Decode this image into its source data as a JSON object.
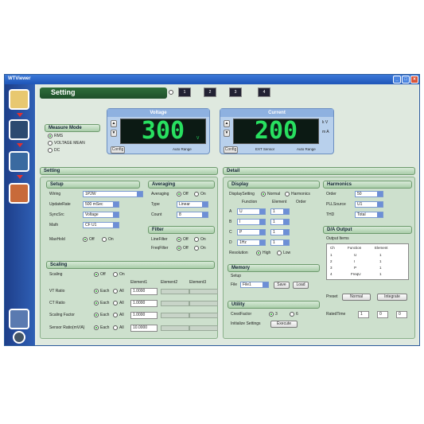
{
  "app": {
    "title": "WTViewer"
  },
  "header": {
    "title": "Setting",
    "chips": [
      "1",
      "2",
      "3",
      "4"
    ]
  },
  "measure_mode": {
    "title": "Measure Mode",
    "options": [
      "RMS",
      "VOLTAGE MEAN",
      "DC"
    ],
    "selected": "RMS"
  },
  "voltage": {
    "title": "Voltage",
    "value": "300",
    "unit": "V",
    "config": "Config",
    "auto": "Auto Range"
  },
  "current": {
    "title": "Current",
    "value": "200",
    "unit_top": "k V",
    "unit_bottom": "m A",
    "config": "Config",
    "ext": "EXT Sensor",
    "auto": "Auto Range"
  },
  "setting": {
    "title": "Setting"
  },
  "setup": {
    "title": "Setup",
    "wiring_label": "Wiring",
    "wiring": "1P2W",
    "update_label": "UpdateRate",
    "update": "500 mSec",
    "sync_label": "SyncSrc",
    "sync": "Voltage",
    "math_label": "Math",
    "math": "CF U1",
    "maxhold_label": "MaxHold",
    "off": "Off",
    "on": "On"
  },
  "averaging": {
    "title": "Averaging",
    "averaging_label": "Averaging",
    "type_label": "Type",
    "type": "Linear",
    "count_label": "Count",
    "count": "8",
    "off": "Off",
    "on": "On"
  },
  "filter": {
    "title": "Filter",
    "line_label": "LineFilter",
    "freq_label": "FreqFilter",
    "off": "Off",
    "on": "On"
  },
  "scaling": {
    "title": "Scaling",
    "scaling_label": "Scaling",
    "off": "Off",
    "on": "On",
    "cols": [
      "Element1",
      "Element2",
      "Element3"
    ],
    "rows": [
      {
        "label": "VT Ratio",
        "value": "1.0000"
      },
      {
        "label": "CT Ratio",
        "value": "1.0000"
      },
      {
        "label": "Scaling Factor",
        "value": "1.0000"
      },
      {
        "label": "Sensor Ratio(mV/A)",
        "value": "10.0000"
      }
    ],
    "each": "Each",
    "all": "All"
  },
  "detail": {
    "title": "Detail"
  },
  "display": {
    "title": "Display",
    "setting_label": "DisplaySetting",
    "normal": "Normal",
    "harmonics": "Harmonics",
    "col_function": "Function",
    "col_element": "Element",
    "col_order": "Order",
    "rows": [
      {
        "k": "A",
        "fn": "U",
        "el": "1"
      },
      {
        "k": "B",
        "fn": "I",
        "el": "1"
      },
      {
        "k": "C",
        "fn": "P",
        "el": "1"
      },
      {
        "k": "D",
        "fn": "1Hz",
        "el": "1"
      }
    ],
    "resolution_label": "Resolution",
    "high": "High",
    "low": "Low"
  },
  "memory": {
    "title": "Memory",
    "setup": "Setup",
    "file_label": "File",
    "file": "File1",
    "save": "Save",
    "load": "Load"
  },
  "utility": {
    "title": "Utility",
    "crest_label": "CrestFactor",
    "crest_a": "3",
    "crest_b": "6",
    "init_label": "Initialize Settings",
    "execute": "Execute"
  },
  "harmonics": {
    "title": "Harmonics",
    "order_label": "Order",
    "order": "50",
    "pll_label": "PLLSource",
    "pll": "U1",
    "thd_label": "THD",
    "thd": "Total"
  },
  "da_output": {
    "title": "D/A Output",
    "items_label": "Output Items",
    "cols": [
      "Ch",
      "Function",
      "Element"
    ],
    "rows": [
      {
        "ch": "1",
        "fn": "U",
        "el": "1"
      },
      {
        "ch": "2",
        "fn": "I",
        "el": "1"
      },
      {
        "ch": "3",
        "fn": "P",
        "el": "1"
      },
      {
        "ch": "4",
        "fn": "FreqU",
        "el": "1"
      }
    ],
    "preset_label": "Preset",
    "normal": "Normal",
    "integrate": "Integrate",
    "rated_label": "RatedTime",
    "rated_h": "1",
    "rated_m": "0",
    "rated_s": "0"
  }
}
